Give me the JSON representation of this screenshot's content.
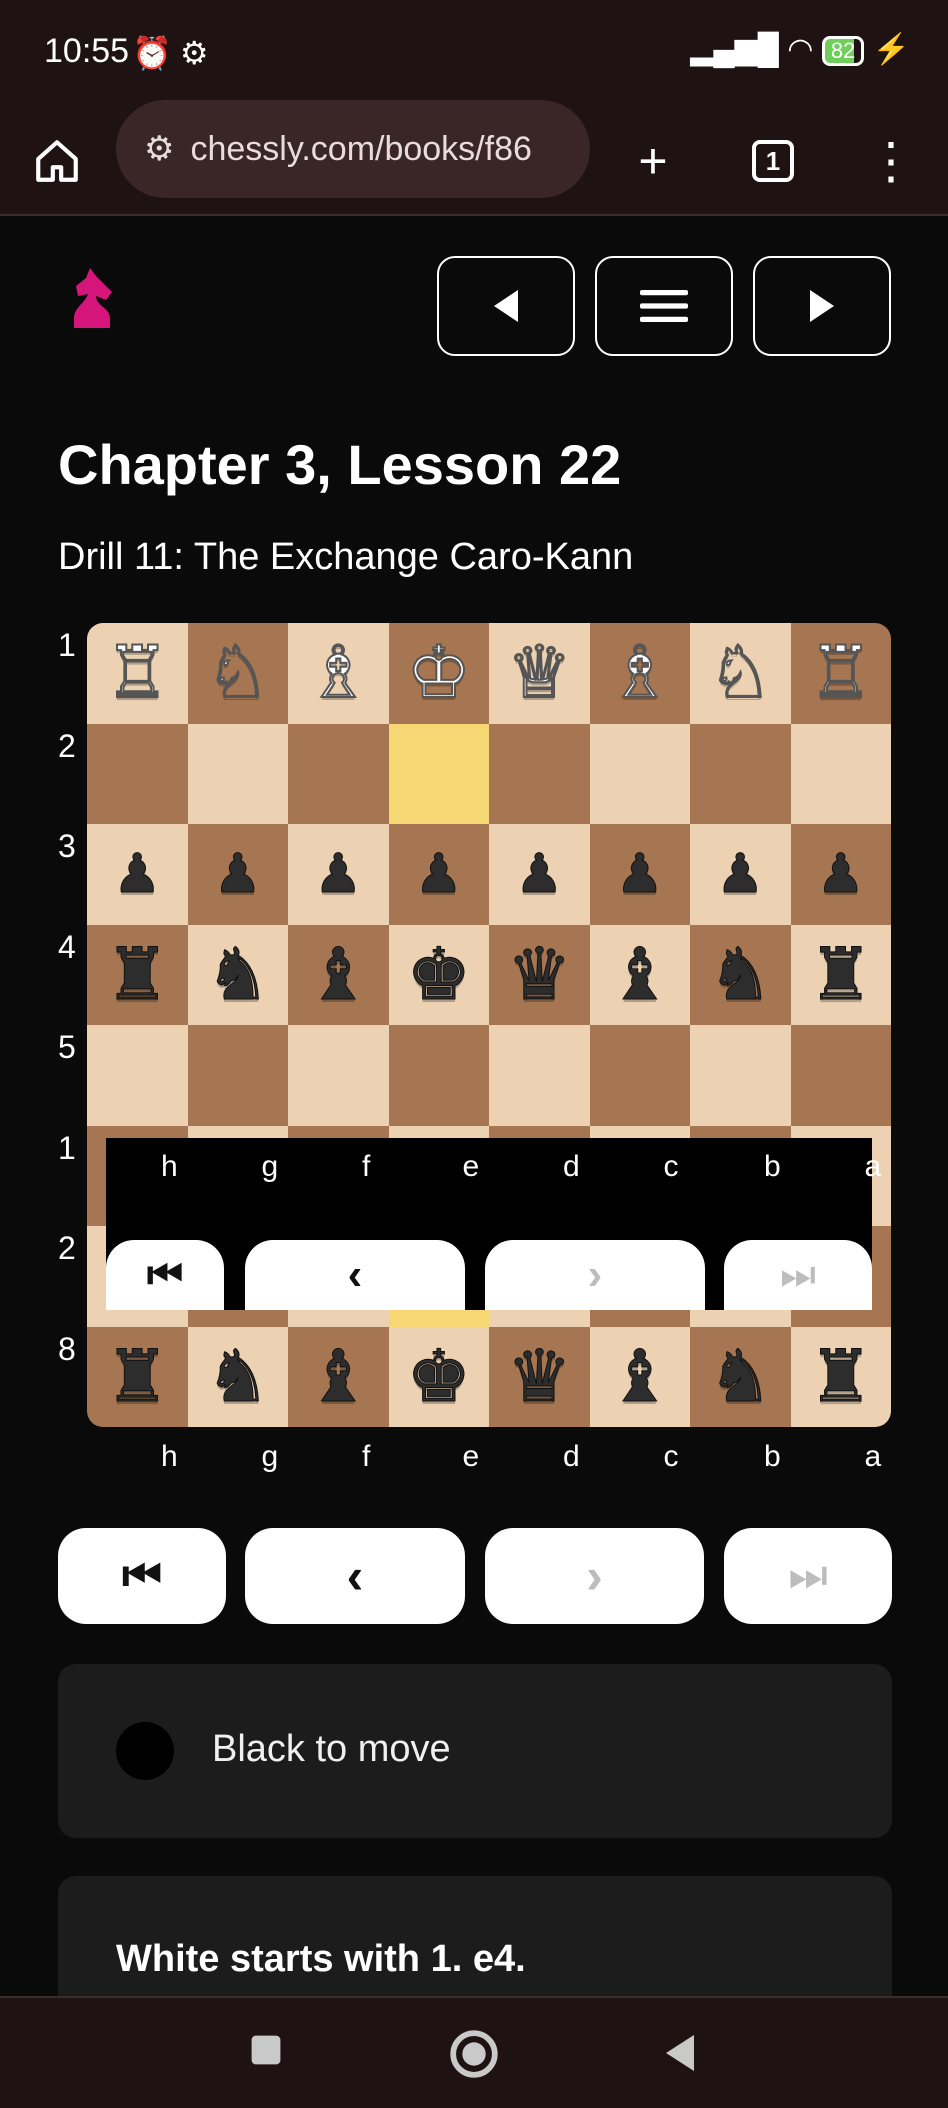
{
  "status_bar": {
    "time": "10:55",
    "battery": "82"
  },
  "browser": {
    "url": "chessly.com/books/f86",
    "tab_count": "1"
  },
  "lesson": {
    "title": "Chapter 3, Lesson 22",
    "drill": "Drill 11: The Exchange Caro-Kann"
  },
  "board": {
    "rank_labels": [
      "1",
      "2",
      "3",
      "4",
      "5",
      "1",
      "2",
      "8"
    ],
    "file_labels": [
      "h",
      "g",
      "f",
      "e",
      "d",
      "c",
      "b",
      "a"
    ],
    "rows": [
      [
        "♖",
        "♘",
        "♗",
        "♔",
        "♕",
        "♗",
        "♘",
        "♖"
      ],
      [
        "",
        "",
        "",
        "",
        "",
        "",
        "",
        ""
      ],
      [
        "♟",
        "♟",
        "♟",
        "♟",
        "♟",
        "♟",
        "♟",
        "♟"
      ],
      [
        "♜",
        "♞",
        "♝",
        "♚",
        "♛",
        "♝",
        "♞",
        "♜"
      ],
      [
        "",
        "",
        "",
        "",
        "",
        "",
        "",
        ""
      ],
      [
        "♖",
        "♘",
        "♗",
        "♔",
        "♕",
        "♗",
        "♘",
        "♖"
      ],
      [
        "♟",
        "♟",
        "♟",
        "♟",
        "♟",
        "♟",
        "♟",
        "♟"
      ],
      [
        "♜",
        "♞",
        "♝",
        "♚",
        "♛",
        "♝",
        "♞",
        "♜"
      ]
    ],
    "highlight_color": "#f6d773",
    "light_square": "#ecd2b3",
    "dark_square": "#a57651"
  },
  "status": {
    "turn_text": "Black to move"
  },
  "comment": {
    "text": "White starts with 1. e4."
  },
  "colors": {
    "brand": "#d6157a",
    "background": "#0a0a0a",
    "card": "#1c1c1c"
  }
}
